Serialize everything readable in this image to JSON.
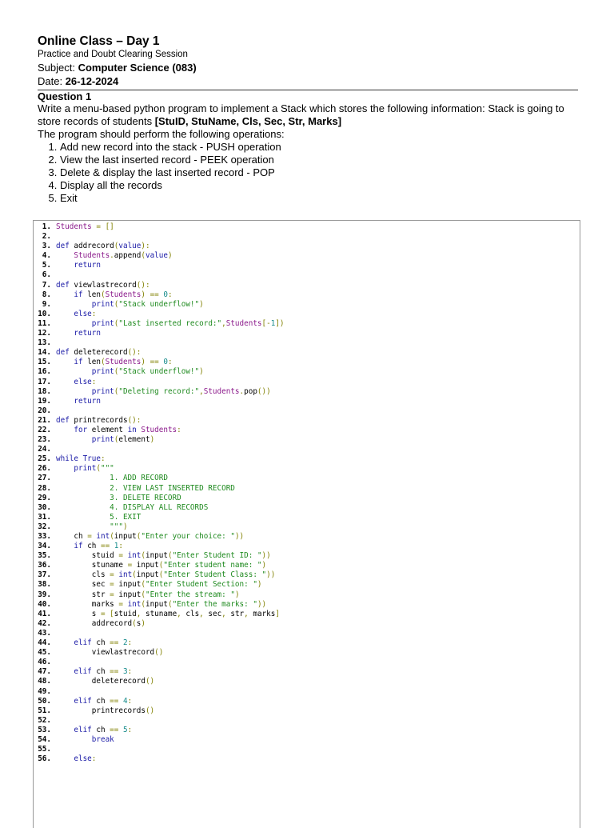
{
  "header": {
    "title": "Online Class – Day 1",
    "session": "Practice and Doubt Clearing Session",
    "subject_label": "Subject: ",
    "subject_value": "Computer Science (083)",
    "date_label": "Date: ",
    "date_value": "26-12-2024"
  },
  "question": {
    "heading": "Question 1",
    "intro": "Write a menu-based python program to implement a Stack which stores the following information:     Stack is going to store records of students ",
    "fields": "[StuID, StuName, Cls, Sec, Str, Marks]",
    "ops_intro": "The program should perform the following operations:",
    "ops": [
      "Add new record into the stack - PUSH operation",
      "View the last inserted record - PEEK operation",
      "Delete & display the last inserted record - POP",
      "Display all the records",
      "Exit"
    ]
  },
  "colors": {
    "keyword": "#1a1aa6",
    "variable": "#8b1a8b",
    "string": "#1f8a1f",
    "number": "#148a8a",
    "punct": "#808000"
  },
  "code": [
    [
      [
        "v",
        "Students"
      ],
      [
        "p",
        " = []"
      ]
    ],
    [],
    [
      [
        "k",
        "def "
      ],
      [
        "t",
        "addrecord"
      ],
      [
        "p",
        "("
      ],
      [
        "k",
        "value"
      ],
      [
        "p",
        "):"
      ]
    ],
    [
      [
        "t",
        "    "
      ],
      [
        "v",
        "Students"
      ],
      [
        "p",
        "."
      ],
      [
        "t",
        "append"
      ],
      [
        "p",
        "("
      ],
      [
        "k",
        "value"
      ],
      [
        "p",
        ")"
      ]
    ],
    [
      [
        "k",
        "    return"
      ]
    ],
    [],
    [
      [
        "k",
        "def "
      ],
      [
        "t",
        "viewlastrecord"
      ],
      [
        "p",
        "():"
      ]
    ],
    [
      [
        "k",
        "    if "
      ],
      [
        "t",
        "len"
      ],
      [
        "p",
        "("
      ],
      [
        "v",
        "Students"
      ],
      [
        "p",
        ") == "
      ],
      [
        "n",
        "0"
      ],
      [
        "p",
        ":"
      ]
    ],
    [
      [
        "k",
        "        print"
      ],
      [
        "p",
        "("
      ],
      [
        "s",
        "\"Stack underflow!\""
      ],
      [
        "p",
        ")"
      ]
    ],
    [
      [
        "k",
        "    else"
      ],
      [
        "p",
        ":"
      ]
    ],
    [
      [
        "k",
        "        print"
      ],
      [
        "p",
        "("
      ],
      [
        "s",
        "\"Last inserted record:\""
      ],
      [
        "p",
        ","
      ],
      [
        "v",
        "Students"
      ],
      [
        "p",
        "[-"
      ],
      [
        "n",
        "1"
      ],
      [
        "p",
        "])"
      ]
    ],
    [
      [
        "k",
        "    return"
      ]
    ],
    [],
    [
      [
        "k",
        "def "
      ],
      [
        "t",
        "deleterecord"
      ],
      [
        "p",
        "():"
      ]
    ],
    [
      [
        "k",
        "    if "
      ],
      [
        "t",
        "len"
      ],
      [
        "p",
        "("
      ],
      [
        "v",
        "Students"
      ],
      [
        "p",
        ") == "
      ],
      [
        "n",
        "0"
      ],
      [
        "p",
        ":"
      ]
    ],
    [
      [
        "k",
        "        print"
      ],
      [
        "p",
        "("
      ],
      [
        "s",
        "\"Stack underflow!\""
      ],
      [
        "p",
        ")"
      ]
    ],
    [
      [
        "k",
        "    else"
      ],
      [
        "p",
        ":"
      ]
    ],
    [
      [
        "k",
        "        print"
      ],
      [
        "p",
        "("
      ],
      [
        "s",
        "\"Deleting record:\""
      ],
      [
        "p",
        ","
      ],
      [
        "v",
        "Students"
      ],
      [
        "p",
        "."
      ],
      [
        "t",
        "pop"
      ],
      [
        "p",
        "())"
      ]
    ],
    [
      [
        "k",
        "    return"
      ]
    ],
    [],
    [
      [
        "k",
        "def "
      ],
      [
        "t",
        "printrecords"
      ],
      [
        "p",
        "():"
      ]
    ],
    [
      [
        "k",
        "    for "
      ],
      [
        "t",
        "element "
      ],
      [
        "k",
        "in "
      ],
      [
        "v",
        "Students"
      ],
      [
        "p",
        ":"
      ]
    ],
    [
      [
        "k",
        "        print"
      ],
      [
        "p",
        "("
      ],
      [
        "t",
        "element"
      ],
      [
        "p",
        ")"
      ]
    ],
    [],
    [
      [
        "k",
        "while True"
      ],
      [
        "p",
        ":"
      ]
    ],
    [
      [
        "k",
        "    print"
      ],
      [
        "p",
        "("
      ],
      [
        "s",
        "\"\"\""
      ]
    ],
    [
      [
        "s",
        "            1. ADD RECORD"
      ]
    ],
    [
      [
        "s",
        "            2. VIEW LAST INSERTED RECORD"
      ]
    ],
    [
      [
        "s",
        "            3. DELETE RECORD"
      ]
    ],
    [
      [
        "s",
        "            4. DISPLAY ALL RECORDS"
      ]
    ],
    [
      [
        "s",
        "            5. EXIT"
      ]
    ],
    [
      [
        "s",
        "            \"\"\""
      ],
      [
        "p",
        ")"
      ]
    ],
    [
      [
        "t",
        "    ch "
      ],
      [
        "p",
        "= "
      ],
      [
        "k",
        "int"
      ],
      [
        "p",
        "("
      ],
      [
        "t",
        "input"
      ],
      [
        "p",
        "("
      ],
      [
        "s",
        "\"Enter your choice: \""
      ],
      [
        "p",
        "))"
      ]
    ],
    [
      [
        "k",
        "    if "
      ],
      [
        "t",
        "ch "
      ],
      [
        "p",
        "== "
      ],
      [
        "n",
        "1"
      ],
      [
        "p",
        ":"
      ]
    ],
    [
      [
        "t",
        "        stuid "
      ],
      [
        "p",
        "= "
      ],
      [
        "k",
        "int"
      ],
      [
        "p",
        "("
      ],
      [
        "t",
        "input"
      ],
      [
        "p",
        "("
      ],
      [
        "s",
        "\"Enter Student ID: \""
      ],
      [
        "p",
        "))"
      ]
    ],
    [
      [
        "t",
        "        stuname "
      ],
      [
        "p",
        "= "
      ],
      [
        "t",
        "input"
      ],
      [
        "p",
        "("
      ],
      [
        "s",
        "\"Enter student name: \""
      ],
      [
        "p",
        ")"
      ]
    ],
    [
      [
        "t",
        "        cls "
      ],
      [
        "p",
        "= "
      ],
      [
        "k",
        "int"
      ],
      [
        "p",
        "("
      ],
      [
        "t",
        "input"
      ],
      [
        "p",
        "("
      ],
      [
        "s",
        "\"Enter Student Class: \""
      ],
      [
        "p",
        "))"
      ]
    ],
    [
      [
        "t",
        "        sec "
      ],
      [
        "p",
        "= "
      ],
      [
        "t",
        "input"
      ],
      [
        "p",
        "("
      ],
      [
        "s",
        "\"Enter Student Section: \""
      ],
      [
        "p",
        ")"
      ]
    ],
    [
      [
        "t",
        "        str "
      ],
      [
        "p",
        "= "
      ],
      [
        "t",
        "input"
      ],
      [
        "p",
        "("
      ],
      [
        "s",
        "\"Enter the stream: \""
      ],
      [
        "p",
        ")"
      ]
    ],
    [
      [
        "t",
        "        marks "
      ],
      [
        "p",
        "= "
      ],
      [
        "k",
        "int"
      ],
      [
        "p",
        "("
      ],
      [
        "t",
        "input"
      ],
      [
        "p",
        "("
      ],
      [
        "s",
        "\"Enter the marks: \""
      ],
      [
        "p",
        "))"
      ]
    ],
    [
      [
        "t",
        "        s "
      ],
      [
        "p",
        "= ["
      ],
      [
        "t",
        "stuid"
      ],
      [
        "p",
        ", "
      ],
      [
        "t",
        "stuname"
      ],
      [
        "p",
        ", "
      ],
      [
        "t",
        "cls"
      ],
      [
        "p",
        ", "
      ],
      [
        "t",
        "sec"
      ],
      [
        "p",
        ", "
      ],
      [
        "t",
        "str"
      ],
      [
        "p",
        ", "
      ],
      [
        "t",
        "marks"
      ],
      [
        "p",
        "]"
      ]
    ],
    [
      [
        "t",
        "        addrecord"
      ],
      [
        "p",
        "("
      ],
      [
        "t",
        "s"
      ],
      [
        "p",
        ")"
      ]
    ],
    [],
    [
      [
        "k",
        "    elif "
      ],
      [
        "t",
        "ch "
      ],
      [
        "p",
        "== "
      ],
      [
        "n",
        "2"
      ],
      [
        "p",
        ":"
      ]
    ],
    [
      [
        "t",
        "        viewlastrecord"
      ],
      [
        "p",
        "()"
      ]
    ],
    [],
    [
      [
        "k",
        "    elif "
      ],
      [
        "t",
        "ch "
      ],
      [
        "p",
        "== "
      ],
      [
        "n",
        "3"
      ],
      [
        "p",
        ":"
      ]
    ],
    [
      [
        "t",
        "        deleterecord"
      ],
      [
        "p",
        "()"
      ]
    ],
    [],
    [
      [
        "k",
        "    elif "
      ],
      [
        "t",
        "ch "
      ],
      [
        "p",
        "== "
      ],
      [
        "n",
        "4"
      ],
      [
        "p",
        ":"
      ]
    ],
    [
      [
        "t",
        "        printrecords"
      ],
      [
        "p",
        "()"
      ]
    ],
    [],
    [
      [
        "k",
        "    elif "
      ],
      [
        "t",
        "ch "
      ],
      [
        "p",
        "== "
      ],
      [
        "n",
        "5"
      ],
      [
        "p",
        ":"
      ]
    ],
    [
      [
        "k",
        "        break"
      ]
    ],
    [],
    [
      [
        "k",
        "    else"
      ],
      [
        "p",
        ":"
      ]
    ]
  ]
}
